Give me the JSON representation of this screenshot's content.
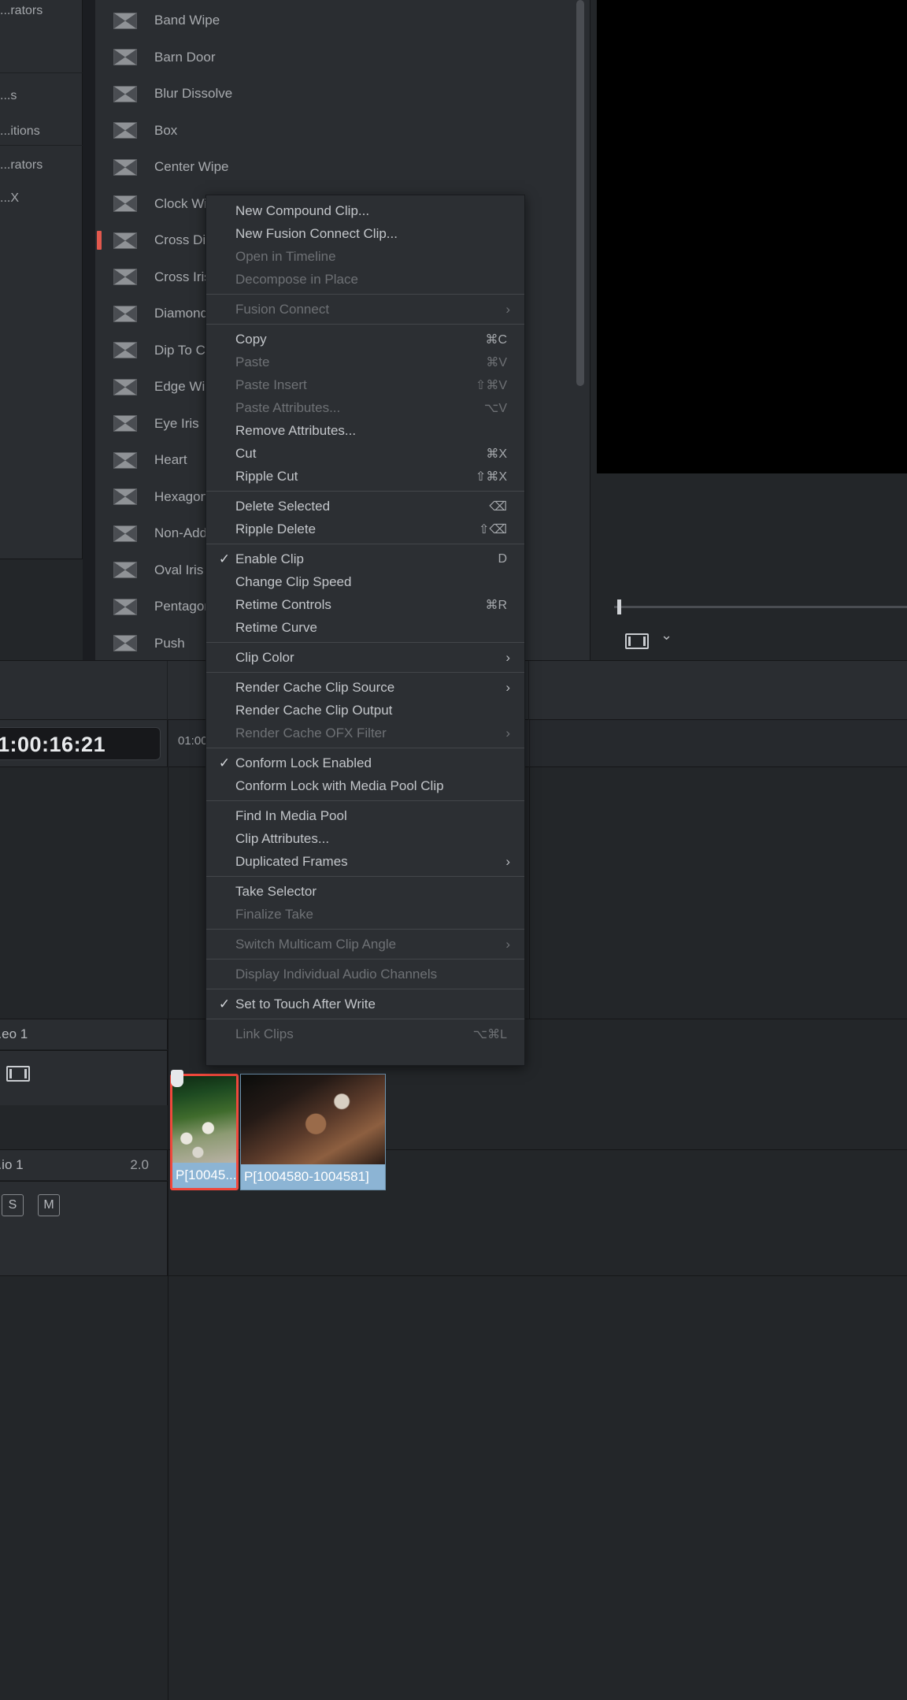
{
  "library": {
    "nav_items": [
      {
        "label": "...rators"
      },
      {
        "label": ""
      },
      {
        "label": "...s"
      },
      {
        "label": "...itions"
      },
      {
        "label": "...rators"
      },
      {
        "label": "...X"
      }
    ],
    "transitions": [
      {
        "label": "Band Wipe",
        "marker": false
      },
      {
        "label": "Barn Door",
        "marker": false
      },
      {
        "label": "Blur Dissolve",
        "marker": false
      },
      {
        "label": "Box",
        "marker": false
      },
      {
        "label": "Center Wipe",
        "marker": false
      },
      {
        "label": "Clock Wipe",
        "marker": false
      },
      {
        "label": "Cross Dissolve",
        "marker": true
      },
      {
        "label": "Cross Iris",
        "marker": false
      },
      {
        "label": "Diamond Iris",
        "marker": false
      },
      {
        "label": "Dip To Color Dissolve",
        "marker": false
      },
      {
        "label": "Edge Wipe",
        "marker": false
      },
      {
        "label": "Eye Iris",
        "marker": false
      },
      {
        "label": "Heart",
        "marker": false
      },
      {
        "label": "Hexagon Iris",
        "marker": false
      },
      {
        "label": "Non-Additive Dissolve",
        "marker": false
      },
      {
        "label": "Oval Iris",
        "marker": false
      },
      {
        "label": "Pentagon Iris",
        "marker": false
      },
      {
        "label": "Push",
        "marker": false
      }
    ]
  },
  "context_menu": {
    "groups": [
      {
        "items": [
          {
            "label": "New Compound Clip...",
            "shortcut": "",
            "disabled": false,
            "checked": false,
            "submenu": false
          },
          {
            "label": "New Fusion Connect Clip...",
            "shortcut": "",
            "disabled": false,
            "checked": false,
            "submenu": false
          },
          {
            "label": "Open in Timeline",
            "shortcut": "",
            "disabled": true,
            "checked": false,
            "submenu": false
          },
          {
            "label": "Decompose in Place",
            "shortcut": "",
            "disabled": true,
            "checked": false,
            "submenu": false
          }
        ]
      },
      {
        "items": [
          {
            "label": "Fusion Connect",
            "shortcut": "",
            "disabled": true,
            "checked": false,
            "submenu": true
          }
        ]
      },
      {
        "items": [
          {
            "label": "Copy",
            "shortcut": "⌘C",
            "disabled": false,
            "checked": false,
            "submenu": false
          },
          {
            "label": "Paste",
            "shortcut": "⌘V",
            "disabled": true,
            "checked": false,
            "submenu": false
          },
          {
            "label": "Paste Insert",
            "shortcut": "⇧⌘V",
            "disabled": true,
            "checked": false,
            "submenu": false
          },
          {
            "label": "Paste Attributes...",
            "shortcut": "⌥V",
            "disabled": true,
            "checked": false,
            "submenu": false
          },
          {
            "label": "Remove Attributes...",
            "shortcut": "",
            "disabled": false,
            "checked": false,
            "submenu": false
          },
          {
            "label": "Cut",
            "shortcut": "⌘X",
            "disabled": false,
            "checked": false,
            "submenu": false
          },
          {
            "label": "Ripple Cut",
            "shortcut": "⇧⌘X",
            "disabled": false,
            "checked": false,
            "submenu": false
          }
        ]
      },
      {
        "items": [
          {
            "label": "Delete Selected",
            "shortcut": "⌫",
            "disabled": false,
            "checked": false,
            "submenu": false
          },
          {
            "label": "Ripple Delete",
            "shortcut": "⇧⌫",
            "disabled": false,
            "checked": false,
            "submenu": false
          }
        ]
      },
      {
        "items": [
          {
            "label": "Enable Clip",
            "shortcut": "D",
            "disabled": false,
            "checked": true,
            "submenu": false
          },
          {
            "label": "Change Clip Speed",
            "shortcut": "",
            "disabled": false,
            "checked": false,
            "submenu": false
          },
          {
            "label": "Retime Controls",
            "shortcut": "⌘R",
            "disabled": false,
            "checked": false,
            "submenu": false
          },
          {
            "label": "Retime Curve",
            "shortcut": "",
            "disabled": false,
            "checked": false,
            "submenu": false
          }
        ]
      },
      {
        "items": [
          {
            "label": "Clip Color",
            "shortcut": "",
            "disabled": false,
            "checked": false,
            "submenu": true
          }
        ]
      },
      {
        "items": [
          {
            "label": "Render Cache Clip Source",
            "shortcut": "",
            "disabled": false,
            "checked": false,
            "submenu": true
          },
          {
            "label": "Render Cache Clip Output",
            "shortcut": "",
            "disabled": false,
            "checked": false,
            "submenu": false
          },
          {
            "label": "Render Cache OFX Filter",
            "shortcut": "",
            "disabled": true,
            "checked": false,
            "submenu": true
          }
        ]
      },
      {
        "items": [
          {
            "label": "Conform Lock Enabled",
            "shortcut": "",
            "disabled": false,
            "checked": true,
            "submenu": false
          },
          {
            "label": "Conform Lock with Media Pool Clip",
            "shortcut": "",
            "disabled": false,
            "checked": false,
            "submenu": false
          }
        ]
      },
      {
        "items": [
          {
            "label": "Find In Media Pool",
            "shortcut": "",
            "disabled": false,
            "checked": false,
            "submenu": false
          },
          {
            "label": "Clip Attributes...",
            "shortcut": "",
            "disabled": false,
            "checked": false,
            "submenu": false
          },
          {
            "label": "Duplicated Frames",
            "shortcut": "",
            "disabled": false,
            "checked": false,
            "submenu": true
          }
        ]
      },
      {
        "items": [
          {
            "label": "Take Selector",
            "shortcut": "",
            "disabled": false,
            "checked": false,
            "submenu": false
          },
          {
            "label": "Finalize Take",
            "shortcut": "",
            "disabled": true,
            "checked": false,
            "submenu": false
          }
        ]
      },
      {
        "items": [
          {
            "label": "Switch Multicam Clip Angle",
            "shortcut": "",
            "disabled": true,
            "checked": false,
            "submenu": true
          }
        ]
      },
      {
        "items": [
          {
            "label": "Display Individual Audio Channels",
            "shortcut": "",
            "disabled": true,
            "checked": false,
            "submenu": false
          }
        ]
      },
      {
        "items": [
          {
            "label": "Set to Touch After Write",
            "shortcut": "",
            "disabled": false,
            "checked": true,
            "submenu": false
          }
        ]
      },
      {
        "items": [
          {
            "label": "Link Clips",
            "shortcut": "⌥⌘L",
            "disabled": true,
            "checked": false,
            "submenu": false
          }
        ]
      }
    ]
  },
  "timeline": {
    "timecode": "1:00:16:21",
    "ruler_labels": [
      "01:00"
    ],
    "video_track": {
      "name": "...eo 1"
    },
    "audio_track": {
      "name": "...io 1",
      "channels": "2.0",
      "solo": "S",
      "mute": "M"
    },
    "clips": [
      {
        "name": "P[10045...",
        "selected": true
      },
      {
        "name": "P[1004580-1004581]",
        "selected": false
      }
    ]
  },
  "colors": {
    "accent_red": "#f0483c",
    "clip_blue": "#8cb4d4",
    "panel_bg": "#2a2d31",
    "menu_bg": "#2c2f33"
  }
}
